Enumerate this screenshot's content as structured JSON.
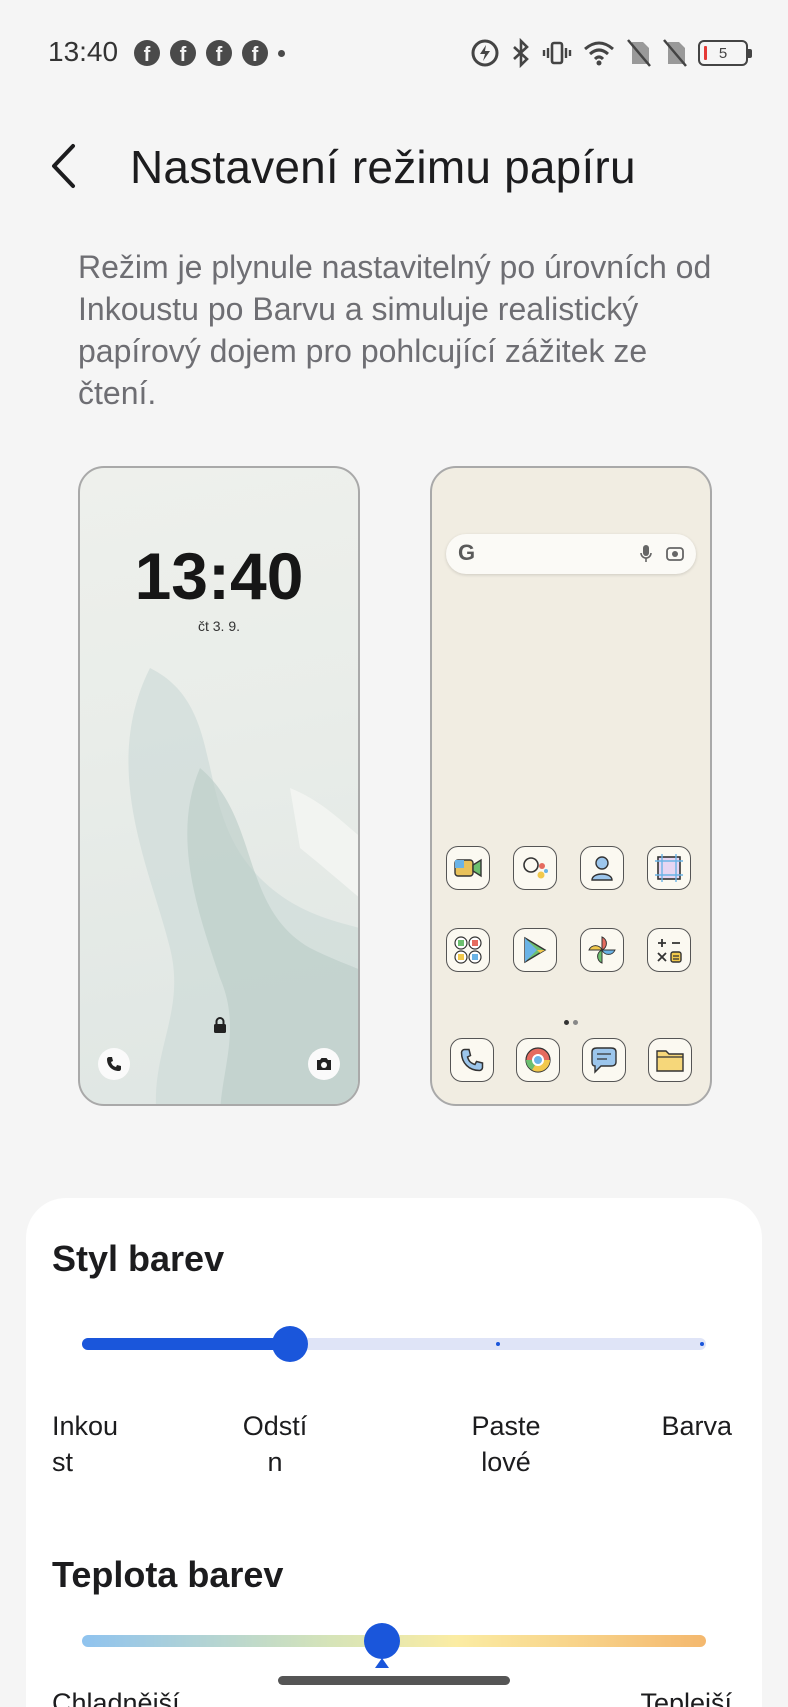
{
  "status_bar": {
    "time": "13:40",
    "notification_icons": [
      "facebook-icon",
      "facebook-icon",
      "facebook-icon",
      "facebook-icon"
    ],
    "battery_level": "5"
  },
  "header": {
    "title": "Nastavení režimu papíru"
  },
  "description": "Režim je plynule nastavitelný po úrovních od Inkoustu po Barvu a simuluje realistický papírový dojem pro pohlcující zážitek ze čtení.",
  "lock_preview": {
    "time": "13:40",
    "date": "čt 3. 9."
  },
  "home_preview": {
    "search_logo": "G",
    "apps": [
      "meet-icon",
      "assistant-icon",
      "contacts-icon",
      "frame-icon",
      "google-folder-icon",
      "play-store-icon",
      "photos-icon",
      "calculator-icon"
    ],
    "dock": [
      "phone-icon",
      "chrome-icon",
      "messages-icon",
      "files-icon"
    ]
  },
  "color_style": {
    "title": "Styl barev",
    "selected_index": 1,
    "stops": [
      "Inkoust",
      "Odstín",
      "Pastelové",
      "Barva"
    ],
    "stop_labels_wrapped": [
      "Inkou\nst",
      "Odstí\nn",
      "Paste\nlové",
      "Barva"
    ]
  },
  "color_temperature": {
    "title": "Teplota barev",
    "value_fraction": 0.48,
    "left_label": "Chladnější",
    "right_label": "Teplejší"
  },
  "colors": {
    "accent": "#1a56db",
    "background": "#f5f5f5",
    "card": "#ffffff"
  }
}
